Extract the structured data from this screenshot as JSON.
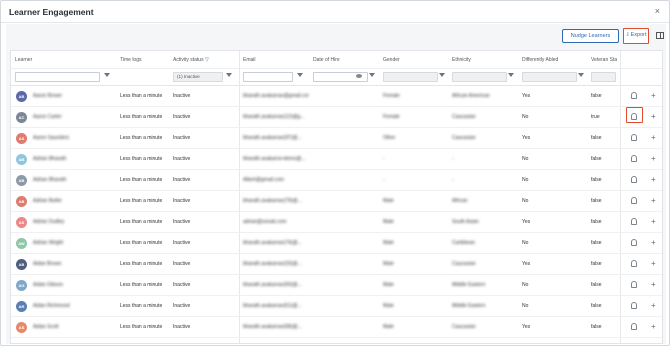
{
  "window": {
    "title": "Learner Engagement",
    "close_glyph": "×"
  },
  "toolbar": {
    "nudge_label": "Nudge Learners",
    "export_label": "Export",
    "export_icon": "export-icon",
    "columns_icon": "columns-icon"
  },
  "columns": [
    "Learner",
    "Time logs",
    "Activity status",
    "Email",
    "Date of Hire",
    "Gender",
    "Ethnicity",
    "Differently Abled",
    "Veteran Stat"
  ],
  "filters": {
    "activity_status": "(1) Inactive"
  },
  "rows": [
    {
      "initials": "AB",
      "name": "Aaron Brown",
      "time": "Less than a minute",
      "status": "Inactive",
      "email": "bharath.avakarrao@gmail.com",
      "gender": "Female",
      "ethnicity": "African American",
      "disabled": "Yes",
      "veteran": "false",
      "avatar_color": "#5a6aa8"
    },
    {
      "initials": "AC",
      "name": "Aaron Carter",
      "time": "Less than a minute",
      "status": "Inactive",
      "email": "bharath.avakarrao(12)@g...",
      "gender": "Female",
      "ethnicity": "Caucasian",
      "disabled": "No",
      "veteran": "true",
      "avatar_color": "#7b8796"
    },
    {
      "initials": "AS",
      "name": "Aaron Saunders",
      "time": "Less than a minute",
      "status": "Inactive",
      "email": "bharath.avakarrao(97)@...",
      "gender": "Other",
      "ethnicity": "Caucasian",
      "disabled": "Yes",
      "veteran": "false",
      "avatar_color": "#e07b70"
    },
    {
      "initials": "AB",
      "name": "Adrian Bharath",
      "time": "Less than a minute",
      "status": "Inactive",
      "email": "bharath.avakarra+demo@...",
      "gender": "-",
      "ethnicity": "-",
      "disabled": "No",
      "veteran": "false",
      "avatar_color": "#8fc6de"
    },
    {
      "initials": "AB",
      "name": "Adrian Bharath",
      "time": "Less than a minute",
      "status": "Inactive",
      "email": "Albert@gmail.com",
      "gender": "-",
      "ethnicity": "-",
      "disabled": "No",
      "veteran": "false",
      "avatar_color": "#8c9aa8"
    },
    {
      "initials": "AB",
      "name": "Adrian Butler",
      "time": "Less than a minute",
      "status": "Inactive",
      "email": "bharath.avakarrao(79)@...",
      "gender": "Male",
      "ethnicity": "African",
      "disabled": "No",
      "veteran": "false",
      "avatar_color": "#e07b70"
    },
    {
      "initials": "AS",
      "name": "Adrian Dudley",
      "time": "Less than a minute",
      "status": "Inactive",
      "email": "adrian@sonab.com",
      "gender": "Male",
      "ethnicity": "South Asian",
      "disabled": "Yes",
      "veteran": "false",
      "avatar_color": "#e88a8a"
    },
    {
      "initials": "AW",
      "name": "Adrian Wright",
      "time": "Less than a minute",
      "status": "Inactive",
      "email": "bharath.avakarrao(74)@...",
      "gender": "Male",
      "ethnicity": "Caribbean",
      "disabled": "No",
      "veteran": "false",
      "avatar_color": "#8fc6a8"
    },
    {
      "initials": "AB",
      "name": "Aidan Brown",
      "time": "Less than a minute",
      "status": "Inactive",
      "email": "bharath.avakarrao(33)@...",
      "gender": "Male",
      "ethnicity": "Caucasian",
      "disabled": "Yes",
      "veteran": "false",
      "avatar_color": "#4f5d7e"
    },
    {
      "initials": "AG",
      "name": "Aidan Gibson",
      "time": "Less than a minute",
      "status": "Inactive",
      "email": "bharath.avakarrao(93)@...",
      "gender": "Male",
      "ethnicity": "Middle Eastern",
      "disabled": "No",
      "veteran": "false",
      "avatar_color": "#7fa8c8"
    },
    {
      "initials": "AR",
      "name": "Aidan Richmond",
      "time": "Less than a minute",
      "status": "Inactive",
      "email": "bharath.avakarrao(51)@...",
      "gender": "Male",
      "ethnicity": "Middle Eastern",
      "disabled": "No",
      "veteran": "false",
      "avatar_color": "#5a7fb0"
    },
    {
      "initials": "AS",
      "name": "Aidan Scott",
      "time": "Less than a minute",
      "status": "Inactive",
      "email": "bharath.avakarrao(58)@...",
      "gender": "Male",
      "ethnicity": "Caucasian",
      "disabled": "Yes",
      "veteran": "false",
      "avatar_color": "#e8896a"
    }
  ],
  "accent": "#2f68b3",
  "highlight": "#e14b2b",
  "inactive_color": "#e14b2b"
}
